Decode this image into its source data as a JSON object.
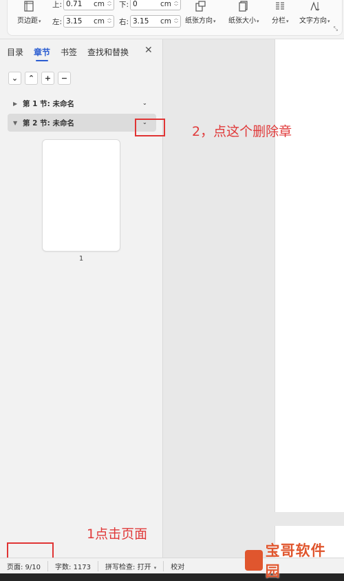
{
  "ribbon": {
    "page_margins": "页边距",
    "margin_top_label": "上:",
    "margin_top_value": "0.71",
    "margin_bottom_label": "下:",
    "margin_bottom_value": "0",
    "margin_left_label": "左:",
    "margin_left_value": "3.15",
    "margin_right_label": "右:",
    "margin_right_value": "3.15",
    "unit": "cm",
    "orientation": "纸张方向",
    "paper_size": "纸张大小",
    "columns": "分栏",
    "text_direction": "文字方向"
  },
  "nav": {
    "tabs": [
      "目录",
      "章节",
      "书签",
      "查找和替换"
    ],
    "active_tab": "章节",
    "sections": [
      {
        "label": "第 1 节: 未命名",
        "expanded": false
      },
      {
        "label": "第 2 节: 未命名",
        "expanded": true
      }
    ],
    "thumbnail_page_number": "1"
  },
  "annotations": {
    "step2": "2，点这个删除章",
    "step1": "1点击页面",
    "color": "#e03434"
  },
  "status": {
    "page": "页面: 9/10",
    "words": "字数: 1173",
    "spell": "拼写检查: 打开",
    "proof": "校对"
  },
  "watermark": {
    "text": "宝哥软件园"
  },
  "colors": {
    "accent": "#2b5dd1",
    "annotation": "#e03434",
    "watermark": "#e0562e"
  }
}
